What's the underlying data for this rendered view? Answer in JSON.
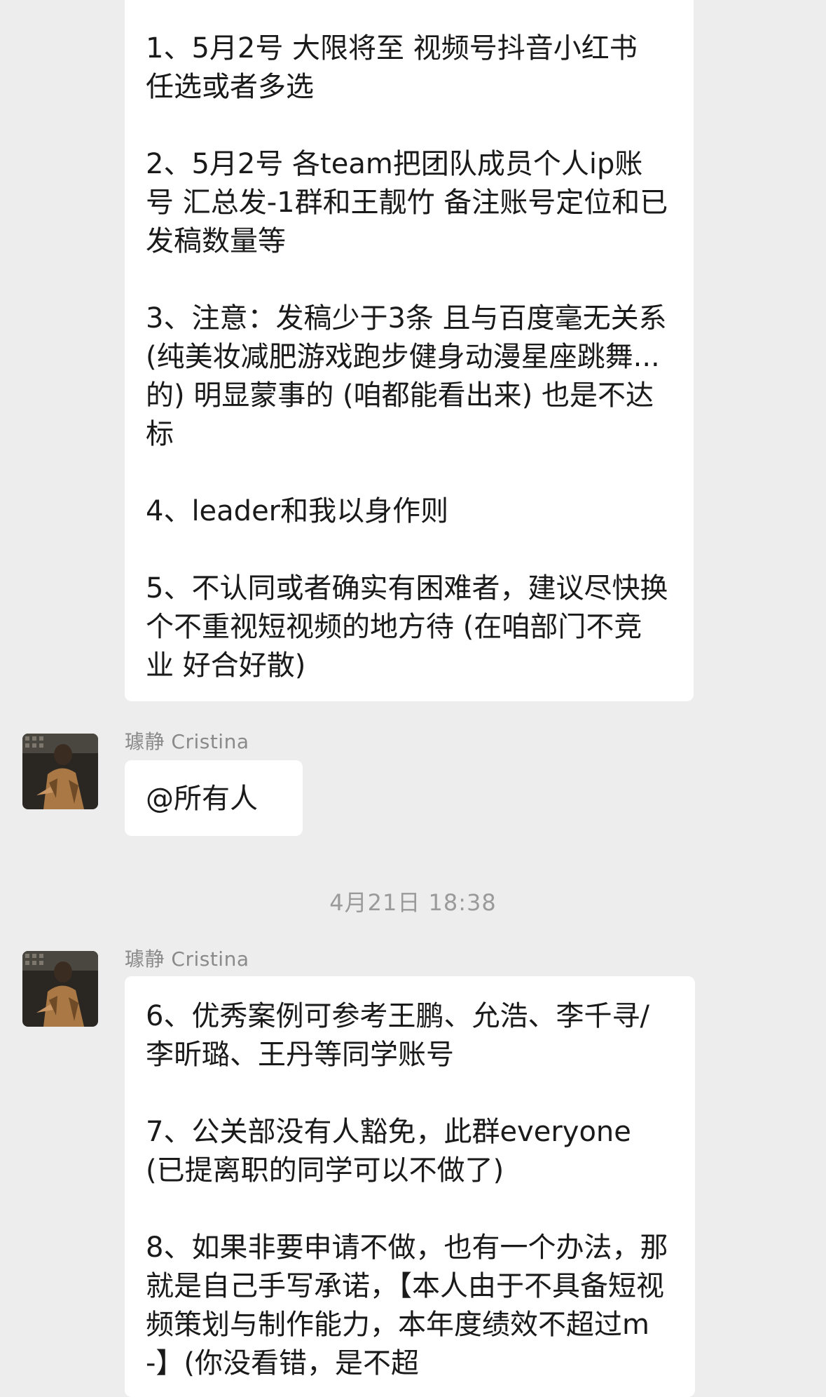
{
  "conversation": {
    "message_1": {
      "paragraphs": [
        "1、5月2号 大限将至  视频号抖音小红书 任选或者多选",
        "2、5月2号 各team把团队成员个人ip账号  汇总发-1群和王靓竹  备注账号定位和已发稿数量等",
        "3、注意：发稿少于3条 且与百度毫无关系 (纯美妆减肥游戏跑步健身动漫星座跳舞...的) 明显蒙事的 (咱都能看出来) 也是不达标",
        "4、leader和我以身作则",
        "5、不认同或者确实有困难者，建议尽快换个不重视短视频的地方待 (在咱部门不竞业 好合好散)"
      ]
    },
    "message_2": {
      "sender": "璩静 Cristina",
      "text": "@所有人"
    },
    "timestamp": "4月21日 18:38",
    "message_3": {
      "sender": "璩静 Cristina",
      "paragraphs": [
        "6、优秀案例可参考王鹏、允浩、李千寻/李昕璐、王丹等同学账号",
        "7、公关部没有人豁免，此群everyone (已提离职的同学可以不做了)",
        "8、如果非要申请不做，也有一个办法，那就是自己手写承诺，【本人由于不具备短视频策划与制作能力，本年度绩效不超过m-】(你没看错，是不超"
      ]
    }
  }
}
